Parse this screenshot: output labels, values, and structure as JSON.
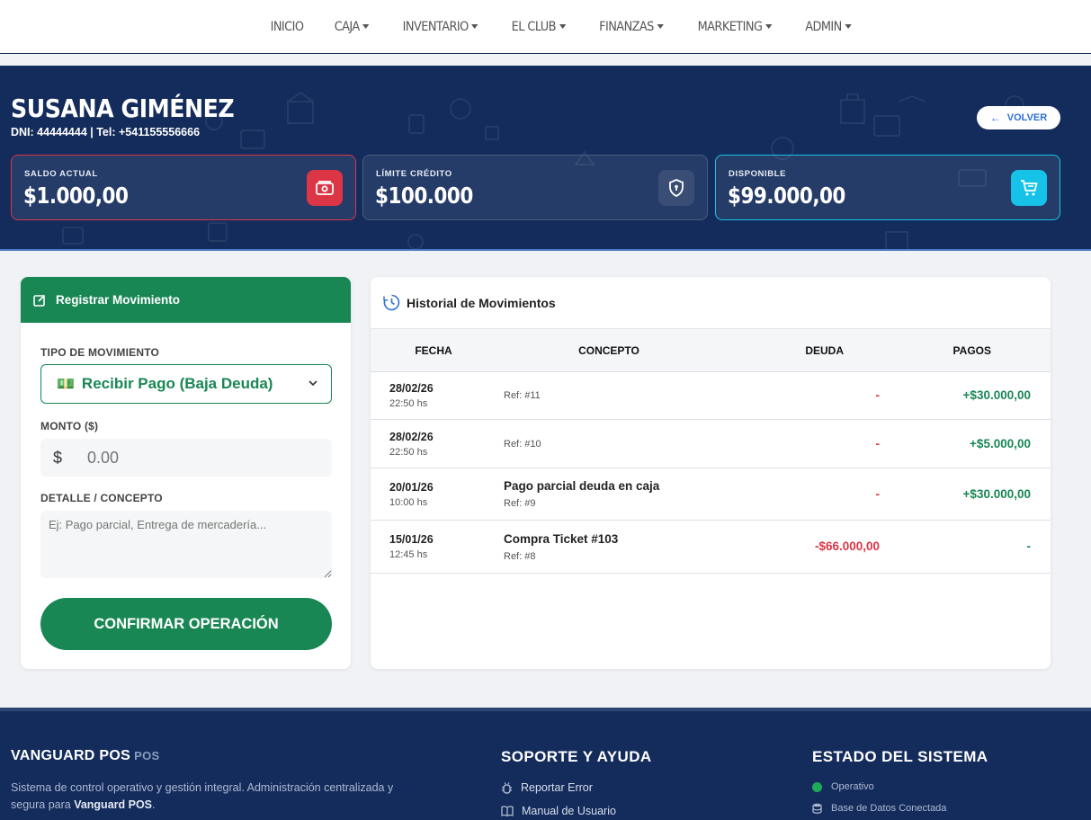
{
  "nav": {
    "items": [
      {
        "label": "INICIO",
        "dropdown": false
      },
      {
        "label": "CAJA",
        "dropdown": true
      },
      {
        "label": "INVENTARIO",
        "dropdown": true
      },
      {
        "label": "EL CLUB",
        "dropdown": true
      },
      {
        "label": "FINANZAS",
        "dropdown": true
      },
      {
        "label": "MARKETING",
        "dropdown": true
      },
      {
        "label": "ADMIN",
        "dropdown": true
      }
    ]
  },
  "client": {
    "name": "SUSANA GIMÉNEZ",
    "details": "DNI: 44444444 | Tel: +541155556666",
    "back_label": "VOLVER"
  },
  "stats": {
    "saldo": {
      "label": "SALDO ACTUAL",
      "value": "$1.000,00",
      "icon": "cash-icon"
    },
    "limite": {
      "label": "LÍMITE CRÉDITO",
      "value": "$100.000",
      "icon": "shield-lock-icon"
    },
    "disponible": {
      "label": "DISPONIBLE",
      "value": "$99.000,00",
      "icon": "cart-icon"
    }
  },
  "form": {
    "title": "Registrar Movimiento",
    "tipo_label": "TIPO DE MOVIMIENTO",
    "tipo_value": "Recibir Pago (Baja Deuda)",
    "tipo_emoji": "💵",
    "monto_label": "MONTO ($)",
    "currency_symbol": "$",
    "monto_placeholder": "0.00",
    "detalle_label": "DETALLE / CONCEPTO",
    "detalle_placeholder": "Ej: Pago parcial, Entrega de mercadería...",
    "confirm_label": "CONFIRMAR OPERACIÓN"
  },
  "history": {
    "title": "Historial de Movimientos",
    "columns": [
      "FECHA",
      "CONCEPTO",
      "DEUDA",
      "PAGOS"
    ],
    "rows": [
      {
        "date": "28/02/26",
        "time": "22:50 hs",
        "concept": "",
        "ref": "Ref: #11",
        "debt": "-",
        "payment": "+$30.000,00"
      },
      {
        "date": "28/02/26",
        "time": "22:50 hs",
        "concept": "",
        "ref": "Ref: #10",
        "debt": "-",
        "payment": "+$5.000,00"
      },
      {
        "date": "20/01/26",
        "time": "10:00 hs",
        "concept": "Pago parcial deuda en caja",
        "ref": "Ref: #9",
        "debt": "-",
        "payment": "+$30.000,00"
      },
      {
        "date": "15/01/26",
        "time": "12:45 hs",
        "concept": "Compra Ticket #103",
        "ref": "Ref: #8",
        "debt": "-$66.000,00",
        "payment": "-"
      }
    ]
  },
  "footer": {
    "brand": "VANGUARD POS",
    "brand_sub": "POS",
    "desc_prefix": "Sistema de control operativo y gestión integral. Administración centralizada y segura para ",
    "desc_bold": "Vanguard POS",
    "desc_suffix": ".",
    "support_title": "SOPORTE Y AYUDA",
    "support_links": [
      "Reportar Error",
      "Manual de Usuario"
    ],
    "status_title": "ESTADO DEL SISTEMA",
    "status_items": [
      "Operativo",
      "Base de Datos Conectada"
    ]
  },
  "colors": {
    "primary_dark": "#142c5c",
    "success": "#198754",
    "danger": "#dc3545",
    "info": "#17c2e8"
  }
}
